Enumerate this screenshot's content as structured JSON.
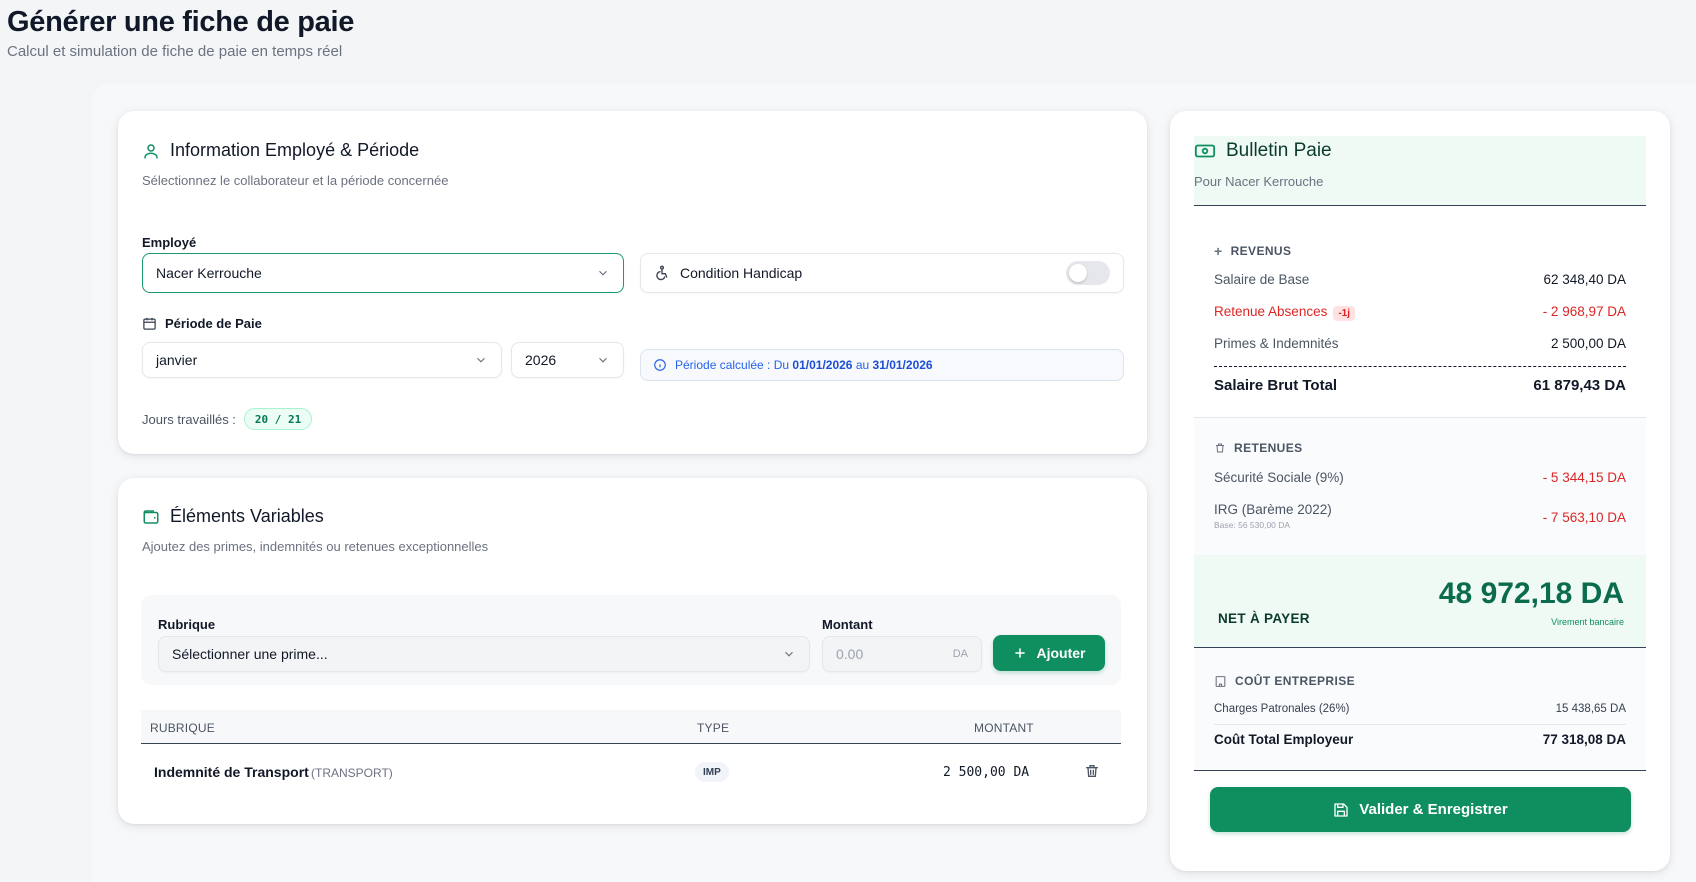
{
  "page": {
    "title": "Générer une fiche de paie",
    "subtitle": "Calcul et simulation de fiche de paie en temps réel"
  },
  "employee_card": {
    "title": "Information Employé & Période",
    "subtitle": "Sélectionnez le collaborateur et la période concernée",
    "employee_label": "Employé",
    "employee_value": "Nacer Kerrouche",
    "handicap_label": "Condition Handicap",
    "handicap_enabled": false,
    "period_label": "Période de Paie",
    "month_value": "janvier",
    "year_value": "2026",
    "period_info_prefix": "Période calculée : Du",
    "period_start": "01/01/2026",
    "period_mid": "au",
    "period_end": "31/01/2026",
    "days_label": "Jours travaillés :",
    "days_value": "20 / 21"
  },
  "variables_card": {
    "title": "Éléments Variables",
    "subtitle": "Ajoutez des primes, indemnités ou retenues exceptionnelles",
    "rubrique_label": "Rubrique",
    "rubrique_placeholder": "Sélectionner une prime...",
    "montant_label": "Montant",
    "montant_placeholder": "0.00",
    "montant_unit": "DA",
    "add_button": "Ajouter",
    "table_headers": [
      "RUBRIQUE",
      "TYPE",
      "MONTANT"
    ],
    "rows": [
      {
        "name": "Indemnité de Transport",
        "code": "(TRANSPORT)",
        "type": "IMP",
        "amount": "2 500,00 DA"
      }
    ]
  },
  "bulletin": {
    "title": "Bulletin Paie",
    "subtitle": "Pour Nacer Kerrouche",
    "revenus_title": "REVENUS",
    "salaire_base_label": "Salaire de Base",
    "salaire_base_value": "62 348,40 DA",
    "absence_label": "Retenue Absences",
    "absence_badge": "-1j",
    "absence_value": "- 2 968,97 DA",
    "primes_label": "Primes & Indemnités",
    "primes_value": "2 500,00 DA",
    "brut_label": "Salaire Brut Total",
    "brut_value": "61 879,43 DA",
    "retenues_title": "RETENUES",
    "secu_label": "Sécurité Sociale (9%)",
    "secu_value": "- 5 344,15 DA",
    "irg_label": "IRG (Barème 2022)",
    "irg_base": "Base: 56 530,00 DA",
    "irg_value": "- 7 563,10 DA",
    "net_label": "NET À PAYER",
    "net_value": "48 972,18 DA",
    "net_mode": "Virement bancaire",
    "cout_title": "COÛT ENTREPRISE",
    "charges_label": "Charges Patronales (26%)",
    "charges_value": "15 438,65 DA",
    "cout_total_label": "Coût Total Employeur",
    "cout_total_value": "77 318,08 DA",
    "validate_button": "Valider & Enregistrer"
  },
  "colors": {
    "accent": "#0f8f5f",
    "danger": "#dc2626",
    "info": "#2563eb"
  }
}
